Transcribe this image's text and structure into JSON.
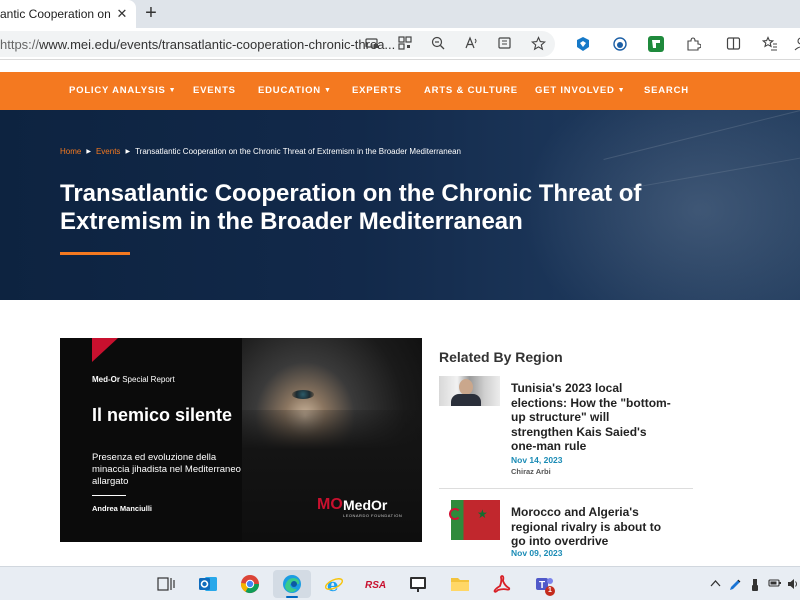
{
  "browser": {
    "tab_title": "antic Cooperation on the C",
    "tab_close": "✕",
    "new_tab": "+",
    "url_scheme": "https://",
    "url_rest": "www.mei.edu/events/transatlantic-cooperation-chronic-threa..."
  },
  "nav": {
    "items": [
      {
        "label": "POLICY ANALYSIS",
        "caret": "▼"
      },
      {
        "label": "EVENTS"
      },
      {
        "label": "EDUCATION",
        "caret": "▼"
      },
      {
        "label": "EXPERTS"
      },
      {
        "label": "ARTS & CULTURE"
      },
      {
        "label": "GET INVOLVED",
        "caret": "▼"
      },
      {
        "label": "SEARCH"
      }
    ]
  },
  "hero": {
    "breadcrumb": {
      "home": "Home",
      "events": "Events",
      "current": "Transatlantic Cooperation on the Chronic Threat of Extremism in the Broader Mediterranean",
      "separator": "▶"
    },
    "title": "Transatlantic Cooperation on the Chronic Threat of Extremism in the Broader Mediterranean"
  },
  "feature": {
    "kicker_bold": "Med-Or",
    "kicker_rest": " Special Report",
    "headline": "Il nemico silente",
    "subtitle": "Presenza ed evoluzione della minaccia jihadista nel Mediterraneo allargato",
    "author": "Andrea Manciulli",
    "logo_mark": "MO",
    "logo_name": "MedOr",
    "logo_foundation": "LEONARDO FOUNDATION"
  },
  "related": {
    "heading": "Related By Region",
    "articles": [
      {
        "title": "Tunisia's 2023 local elections: How the \"bottom-up structure\" will strengthen Kais Saied's one-man rule",
        "date": "Nov 14, 2023",
        "author": "Chiraz Arbi"
      },
      {
        "title": "Morocco and Algeria's regional rivalry is about to go into overdrive",
        "date": "Nov 09, 2023",
        "author": ""
      }
    ]
  },
  "taskbar": {
    "notification_count": "1",
    "colors": {
      "outlook": "#0f6cbd",
      "chrome": "#e3a21a",
      "edge": "#1b9de2",
      "ie": "#1ea1f1",
      "rsa": "#c8102e",
      "folder": "#f3c33c",
      "acrobat": "#d81f26"
    }
  },
  "theme": {
    "accent": "#f47920",
    "hero_bg": "#12294a",
    "date_color": "#1a8bb5"
  }
}
